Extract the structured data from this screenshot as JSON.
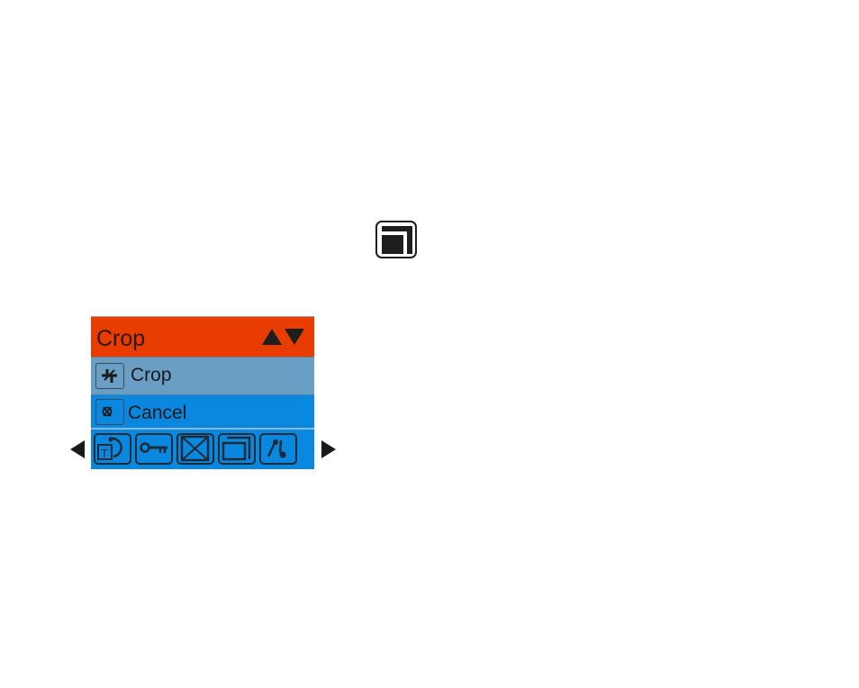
{
  "top_icon": {
    "icon": "window-layout-icon"
  },
  "menu": {
    "title": "Crop",
    "title_icon": "up-down-arrows-icon",
    "items": [
      {
        "label": "Crop",
        "icon": "crop-icon",
        "state": "normal"
      },
      {
        "label": "Cancel",
        "icon": "cancel-icon",
        "state": "selected"
      }
    ],
    "toolbar": [
      {
        "name": "text-rotate",
        "icon": "text-rotate-icon"
      },
      {
        "name": "protect",
        "icon": "key-icon"
      },
      {
        "name": "delete",
        "icon": "delete-box-icon"
      },
      {
        "name": "window",
        "icon": "window-frame-icon"
      },
      {
        "name": "edit",
        "icon": "pen-edit-icon"
      }
    ],
    "nav_prev": "previous-arrow-icon",
    "nav_next": "next-arrow-icon"
  },
  "colors": {
    "header": "#e83c00",
    "item_normal": "#6a9ec4",
    "item_selected": "#0a88e0",
    "toolbar": "#0a88e0"
  }
}
